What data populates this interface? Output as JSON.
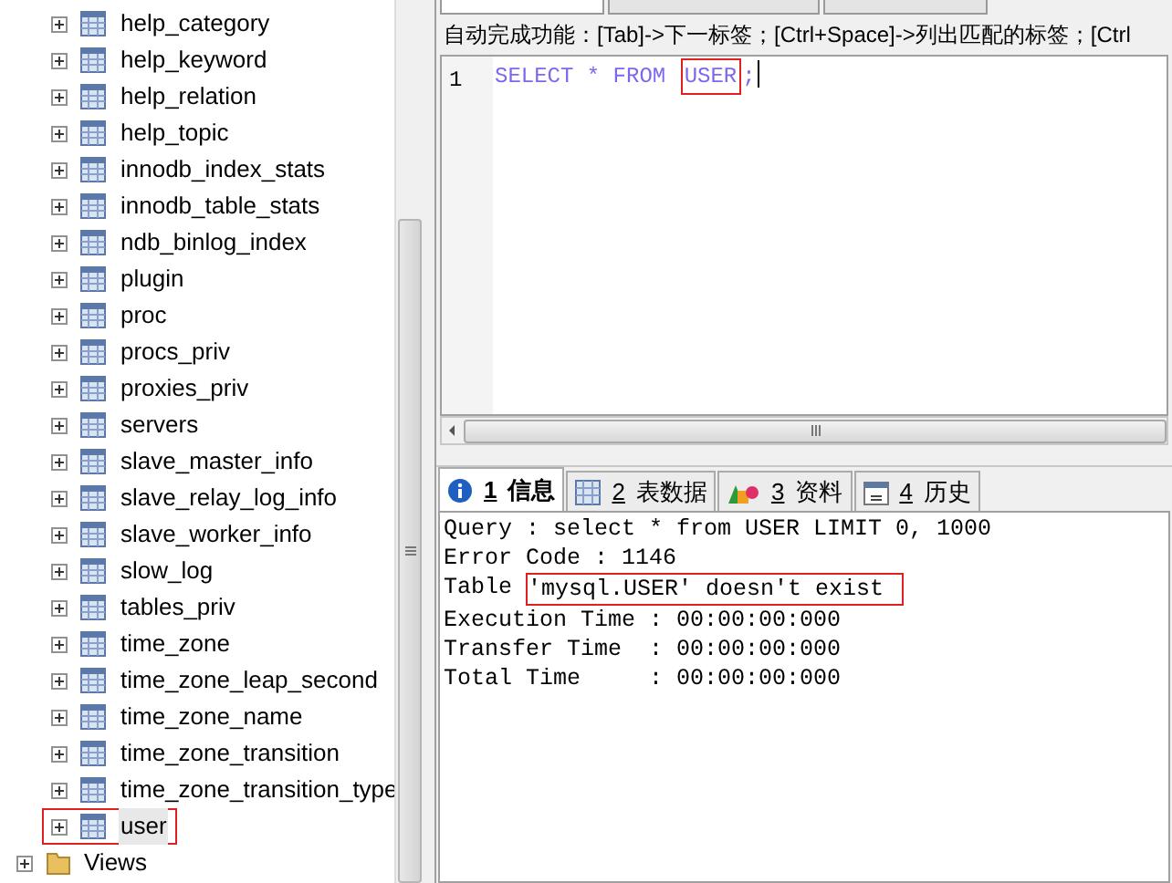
{
  "tree": {
    "items": [
      {
        "label": "help_category",
        "highlighted": false
      },
      {
        "label": "help_keyword",
        "highlighted": false
      },
      {
        "label": "help_relation",
        "highlighted": false
      },
      {
        "label": "help_topic",
        "highlighted": false
      },
      {
        "label": "innodb_index_stats",
        "highlighted": false
      },
      {
        "label": "innodb_table_stats",
        "highlighted": false
      },
      {
        "label": "ndb_binlog_index",
        "highlighted": false
      },
      {
        "label": "plugin",
        "highlighted": false
      },
      {
        "label": "proc",
        "highlighted": false
      },
      {
        "label": "procs_priv",
        "highlighted": false
      },
      {
        "label": "proxies_priv",
        "highlighted": false
      },
      {
        "label": "servers",
        "highlighted": false
      },
      {
        "label": "slave_master_info",
        "highlighted": false
      },
      {
        "label": "slave_relay_log_info",
        "highlighted": false
      },
      {
        "label": "slave_worker_info",
        "highlighted": false
      },
      {
        "label": "slow_log",
        "highlighted": false
      },
      {
        "label": "tables_priv",
        "highlighted": false
      },
      {
        "label": "time_zone",
        "highlighted": false
      },
      {
        "label": "time_zone_leap_second",
        "highlighted": false
      },
      {
        "label": "time_zone_name",
        "highlighted": false
      },
      {
        "label": "time_zone_transition",
        "highlighted": false
      },
      {
        "label": "time_zone_transition_type",
        "highlighted": false
      },
      {
        "label": "user",
        "highlighted": true
      }
    ],
    "folder": {
      "label": "Views"
    }
  },
  "editor": {
    "hint": "自动完成功能：[Tab]->下一标签；[Ctrl+Space]->列出匹配的标签；[Ctrl",
    "line_number": "1",
    "tokens": [
      {
        "text": "SELECT * FROM ",
        "highlighted": false
      },
      {
        "text": "USER",
        "highlighted": true
      },
      {
        "text": ";",
        "highlighted": false
      }
    ]
  },
  "result_tabs": [
    {
      "number": "1",
      "label": "信息",
      "kind": "info",
      "selected": true
    },
    {
      "number": "2",
      "label": "表数据",
      "kind": "grid",
      "selected": false
    },
    {
      "number": "3",
      "label": "资料",
      "kind": "shapes",
      "selected": false
    },
    {
      "number": "4",
      "label": "历史",
      "kind": "calendar",
      "selected": false
    }
  ],
  "output": [
    {
      "text": "Query : select * from USER LIMIT 0, 1000"
    },
    {
      "text": "Error Code : 1146"
    },
    {
      "prefix": "Table ",
      "highlight": "'mysql.USER' doesn't exist"
    },
    {
      "text": "Execution Time : 00:00:00:000"
    },
    {
      "text": "Transfer Time  : 00:00:00:000"
    },
    {
      "text": "Total Time     : 00:00:00:000"
    }
  ]
}
